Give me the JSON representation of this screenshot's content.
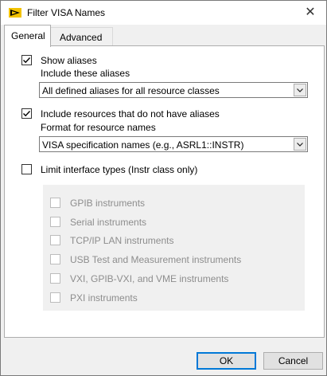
{
  "window": {
    "title": "Filter VISA Names"
  },
  "tabs": [
    {
      "label": "General",
      "active": true
    },
    {
      "label": "Advanced",
      "active": false
    }
  ],
  "general": {
    "show_aliases": {
      "label": "Show aliases",
      "checked": true
    },
    "include_label": "Include these aliases",
    "include_select": {
      "value": "All defined aliases for all resource classes"
    },
    "include_no_alias": {
      "label": "Include resources that do not have aliases",
      "checked": true
    },
    "format_label": "Format for resource names",
    "format_select": {
      "value": "VISA specification names (e.g., ASRL1::INSTR)"
    },
    "limit_interface": {
      "label": "Limit interface types (Instr class only)",
      "checked": false
    },
    "interfaces": [
      {
        "label": "GPIB instruments",
        "checked": false
      },
      {
        "label": "Serial instruments",
        "checked": false
      },
      {
        "label": "TCP/IP LAN instruments",
        "checked": false
      },
      {
        "label": "USB Test and Measurement instruments",
        "checked": false
      },
      {
        "label": "VXI, GPIB-VXI, and VME instruments",
        "checked": false
      },
      {
        "label": "PXI instruments",
        "checked": false
      }
    ]
  },
  "buttons": {
    "ok": "OK",
    "cancel": "Cancel"
  },
  "colors": {
    "accent": "#0078d7",
    "disabled_text": "#8d8d8d",
    "labview_icon": "#f2c200"
  },
  "icons": {
    "app": "labview-arrow-icon",
    "close": "close-icon",
    "check": "checkmark-icon",
    "dropdown": "chevron-down-icon"
  }
}
